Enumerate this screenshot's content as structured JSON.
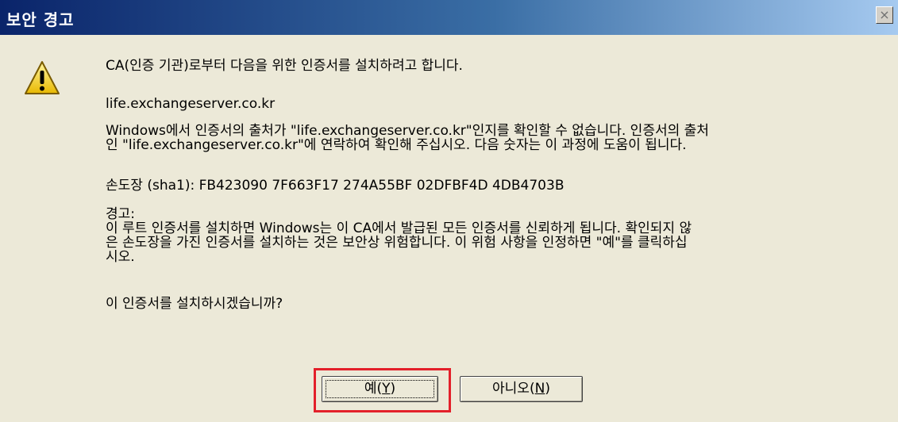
{
  "window": {
    "title": "보안 경고",
    "close_glyph": "×"
  },
  "icon": {
    "name": "warning-icon"
  },
  "message": {
    "line1": "CA(인증 기관)로부터 다음을 위한 인증서를 설치하려고 합니다.",
    "host": "life.exchangeserver.co.kr",
    "origin_text": "Windows에서 인증서의 출처가 \"life.exchangeserver.co.kr\"인지를 확인할 수 없습니다. 인증서의 출처\n인 \"life.exchangeserver.co.kr\"에 연락하여 확인해 주십시오. 다음 숫자는 이 과정에 도움이 됩니다.",
    "thumbprint": "손도장 (sha1): FB423090 7F663F17 274A55BF 02DFBF4D 4DB4703B",
    "warning": "경고:\n이 루트 인증서를 설치하면 Windows는 이 CA에서 발급된 모든 인증서를 신뢰하게 됩니다. 확인되지 않\n은 손도장을 가진 인증서를 설치하는 것은 보안상 위험합니다. 이 위험 사항을 인정하면 \"예\"를 클릭하십\n시오.",
    "question": "이 인증서를 설치하시겠습니까?"
  },
  "buttons": {
    "yes_label": "예(",
    "yes_key": "Y",
    "yes_suffix": ")",
    "no_label": "아니오(",
    "no_key": "N",
    "no_suffix": ")"
  },
  "colors": {
    "titlebar_start": "#0a246a",
    "titlebar_end": "#a6caf0",
    "highlight": "#e3202a",
    "dialog_bg": "#ece9d8"
  }
}
